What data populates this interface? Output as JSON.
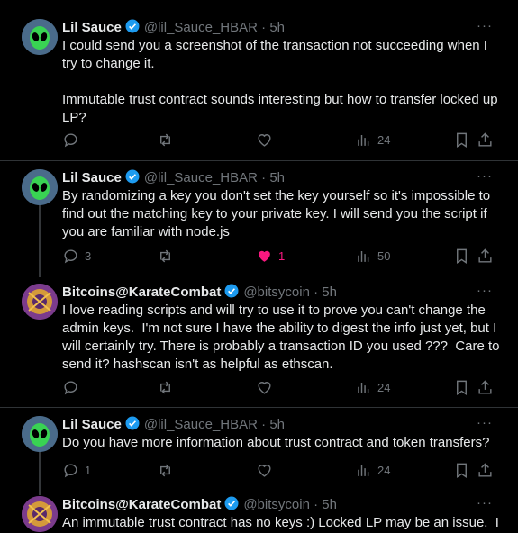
{
  "colors": {
    "background": "#000000",
    "text": "#e7e9ea",
    "muted": "#71767b",
    "verified": "#1d9bf0",
    "like": "#f91880",
    "border": "#2f3336"
  },
  "tweets": [
    {
      "name": "Lil Sauce",
      "handle": "@lil_Sauce_HBAR",
      "dot": "·",
      "time": "5h",
      "avatar": "alien-avatar",
      "text": "I could send you a screenshot of the transaction not succeeding when I try to change it.\n\nImmutable trust contract sounds interesting but how to transfer locked up LP?",
      "replies": "",
      "retweets": "",
      "likes": "",
      "views": "24",
      "liked": false
    },
    {
      "name": "Lil Sauce",
      "handle": "@lil_Sauce_HBAR",
      "dot": "·",
      "time": "5h",
      "avatar": "alien-avatar",
      "text": "By randomizing a key you don't set the key yourself so it's impossible to find out the matching key to your private key. I will send you the script if you are familiar with node.js",
      "replies": "3",
      "retweets": "",
      "likes": "1",
      "views": "50",
      "liked": true
    },
    {
      "name": "Bitcoins@KarateCombat",
      "handle": "@bitsycoin",
      "dot": "·",
      "time": "5h",
      "avatar": "karate-avatar",
      "text": "I love reading scripts and will try to use it to prove you can't change the admin keys.  I'm not sure I have the ability to digest the info just yet, but I will certainly try. There is probably a transaction ID you used ???  Care to send it? hashscan isn't as helpful as ethscan.",
      "replies": "",
      "retweets": "",
      "likes": "",
      "views": "24",
      "liked": false
    },
    {
      "name": "Lil Sauce",
      "handle": "@lil_Sauce_HBAR",
      "dot": "·",
      "time": "5h",
      "avatar": "alien-avatar",
      "text": "Do you have more information about trust contract and token transfers?",
      "replies": "1",
      "retweets": "",
      "likes": "",
      "views": "24",
      "liked": false
    },
    {
      "name": "Bitcoins@KarateCombat",
      "handle": "@bitsycoin",
      "dot": "·",
      "time": "5h",
      "avatar": "karate-avatar",
      "text": "An immutable trust contract has no keys :) Locked LP may be an issue.  I",
      "replies": "",
      "retweets": "",
      "likes": "",
      "views": "",
      "liked": false
    }
  ],
  "more_label": "···"
}
